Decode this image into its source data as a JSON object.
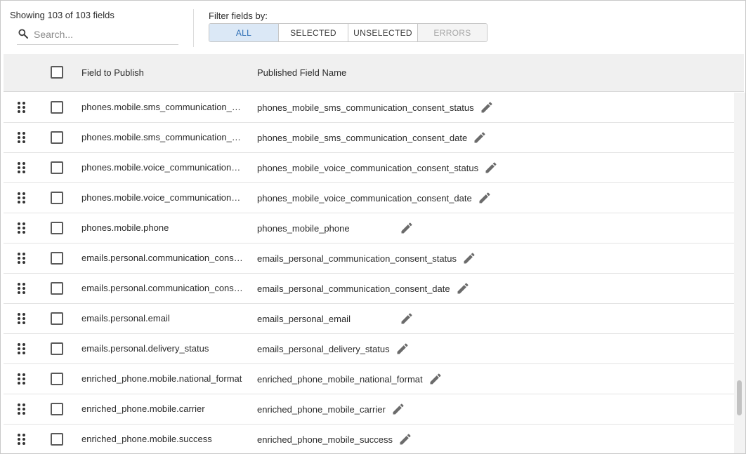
{
  "header": {
    "count_text": "Showing 103 of 103 fields",
    "search_placeholder": "Search...",
    "search_value": "",
    "filter_label": "Filter fields by:",
    "filters": [
      {
        "label": "ALL",
        "state": "active"
      },
      {
        "label": "SELECTED",
        "state": "normal"
      },
      {
        "label": "UNSELECTED",
        "state": "normal"
      },
      {
        "label": "ERRORS",
        "state": "disabled"
      }
    ]
  },
  "table": {
    "col_field": "Field to Publish",
    "col_published": "Published Field Name",
    "rows": [
      {
        "field": "phones.mobile.sms_communication_consent_status",
        "published": "phones_mobile_sms_communication_consent_status",
        "edit_inline": true
      },
      {
        "field": "phones.mobile.sms_communication_consent_date",
        "published": "phones_mobile_sms_communication_consent_date",
        "edit_inline": true
      },
      {
        "field": "phones.mobile.voice_communication_consent_status",
        "published": "phones_mobile_voice_communication_consent_status",
        "edit_inline": true
      },
      {
        "field": "phones.mobile.voice_communication_consent_date",
        "published": "phones_mobile_voice_communication_consent_date",
        "edit_inline": true
      },
      {
        "field": "phones.mobile.phone",
        "published": "phones_mobile_phone",
        "edit_inline": false
      },
      {
        "field": "emails.personal.communication_consent_status",
        "published": "emails_personal_communication_consent_status",
        "edit_inline": true
      },
      {
        "field": "emails.personal.communication_consent_date",
        "published": "emails_personal_communication_consent_date",
        "edit_inline": true
      },
      {
        "field": "emails.personal.email",
        "published": "emails_personal_email",
        "edit_inline": false
      },
      {
        "field": "emails.personal.delivery_status",
        "published": "emails_personal_delivery_status",
        "edit_inline": true
      },
      {
        "field": "enriched_phone.mobile.national_format",
        "published": "enriched_phone_mobile_national_format",
        "edit_inline": true
      },
      {
        "field": "enriched_phone.mobile.carrier",
        "published": "enriched_phone_mobile_carrier",
        "edit_inline": true
      },
      {
        "field": "enriched_phone.mobile.success",
        "published": "enriched_phone_mobile_success",
        "edit_inline": true
      }
    ]
  },
  "icons": {
    "search": "search-icon",
    "drag": "drag-handle-icon",
    "edit": "pencil-icon"
  },
  "colors": {
    "active_filter_bg": "#dbe8f6",
    "active_filter_text": "#2f6fb5",
    "header_bg": "#f0f0f0",
    "icon": "#6b6b6b"
  }
}
